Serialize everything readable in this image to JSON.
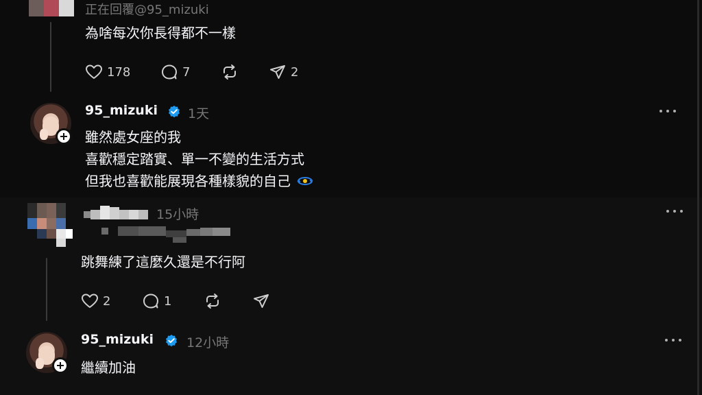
{
  "top_panel": {
    "reply1": {
      "replying_to": "正在回覆@95_mizuki",
      "text": "為啥每次你長得都不一樣",
      "likes": "178",
      "comments": "7",
      "shares": "2"
    },
    "mizuki_reply1": {
      "username": "95_mizuki",
      "time": "1天",
      "lines": [
        "雖然處女座的我",
        "喜歡穩定踏實、單一不變的生活方式",
        "但我也喜歡能展現各種樣貌的自己"
      ]
    }
  },
  "bottom_panel": {
    "reply2": {
      "time": "15小時",
      "text": "跳舞練了這麼久還是不行阿",
      "likes": "2",
      "comments": "1"
    },
    "mizuki_reply2": {
      "username": "95_mizuki",
      "time": "12小時",
      "text": "繼續加油"
    }
  },
  "colors": {
    "verified": "#1d9bf0",
    "text_primary": "#f3f5f7",
    "text_secondary": "#777777"
  },
  "icons": [
    "heart-icon",
    "comment-icon",
    "repost-icon",
    "share-icon",
    "verified-icon",
    "more-icon",
    "follow-plus-icon",
    "emoji-icon"
  ]
}
